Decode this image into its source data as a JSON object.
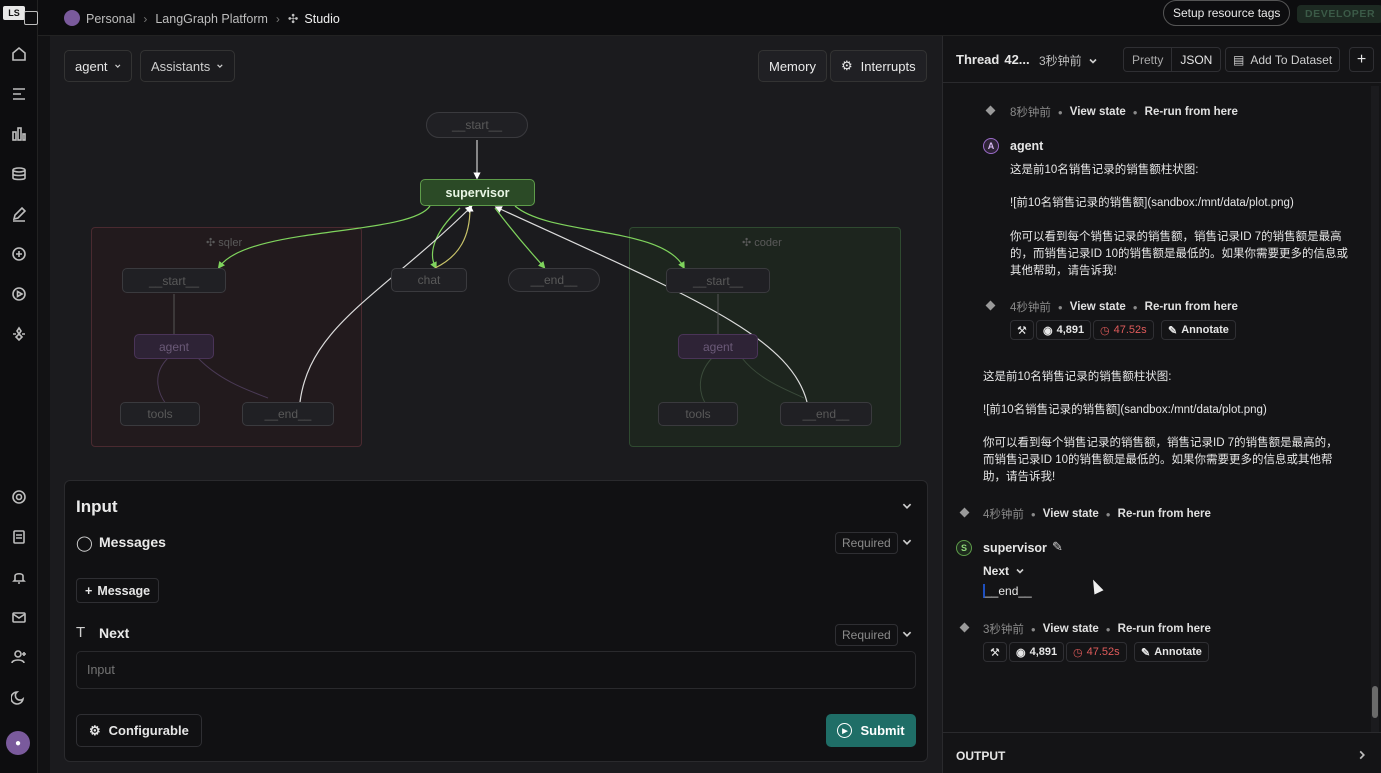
{
  "breadcrumb": {
    "personal": "Personal",
    "platform": "LangGraph Platform",
    "studio": "Studio"
  },
  "topbar": {
    "setup_tags": "Setup resource tags",
    "badge": "DEVELOPER"
  },
  "toolbar": {
    "graph_select": "agent",
    "assistants": "Assistants",
    "memory": "Memory",
    "interrupts": "Interrupts"
  },
  "graph": {
    "start": "__start__",
    "supervisor": "supervisor",
    "chat": "chat",
    "end": "__end__",
    "sqler": {
      "label": "sqler",
      "start": "__start__",
      "agent": "agent",
      "tools": "tools",
      "end": "__end__"
    },
    "coder": {
      "label": "coder",
      "start": "__start__",
      "agent": "agent",
      "tools": "tools",
      "end": "__end__"
    }
  },
  "input": {
    "title": "Input",
    "messages_label": "Messages",
    "required": "Required",
    "add_message": "Message",
    "next_label": "Next",
    "next_placeholder": "Input",
    "configurable": "Configurable",
    "submit": "Submit"
  },
  "thread": {
    "title": "Thread",
    "id": "42...",
    "time": "3秒钟前",
    "pretty": "Pretty",
    "json": "JSON",
    "add_dataset": "Add To Dataset"
  },
  "run": {
    "view_state": "View state",
    "rerun": "Re-run from here",
    "step1_time": "8秒钟前",
    "agent_name": "agent",
    "agent_avatar": "A",
    "agent_line1": "这是前10名销售记录的销售额柱状图:",
    "agent_line2": "![前10名销售记录的销售额](sandbox:/mnt/data/plot.png)",
    "agent_line3a": "你可以看到每个销售记录的销售额，销售记录ID 7的销售额是最高",
    "agent_line3b": "的，而销售记录ID 10的销售额是最低的。如果你需要更多的信息或",
    "agent_line3c": "其他帮助，请告诉我!",
    "step2_time": "4秒钟前",
    "tokens": "4,891",
    "latency": "47.52s",
    "annotate": "Annotate",
    "out_line1": "这是前10名销售记录的销售额柱状图:",
    "out_line2": "![前10名销售记录的销售额](sandbox:/mnt/data/plot.png)",
    "out_line3a": "你可以看到每个销售记录的销售额，销售记录ID 7的销售额是最高的，",
    "out_line3b": "而销售记录ID 10的销售额是最低的。如果你需要更多的信息或其他帮",
    "out_line3c": "助，请告诉我!",
    "step3_time": "4秒钟前",
    "supervisor_name": "supervisor",
    "supervisor_avatar": "S",
    "next_label": "Next",
    "next_value": "__end__",
    "step4_time": "3秒钟前",
    "tokens2": "4,891",
    "latency2": "47.52s",
    "annotate2": "Annotate"
  },
  "output": {
    "label": "OUTPUT"
  },
  "colors": {
    "accent_green": "#5e9c4a",
    "submit_bg": "#1f6e67",
    "latency_red": "#e05b5b",
    "badge_text": "#3b5a47"
  }
}
